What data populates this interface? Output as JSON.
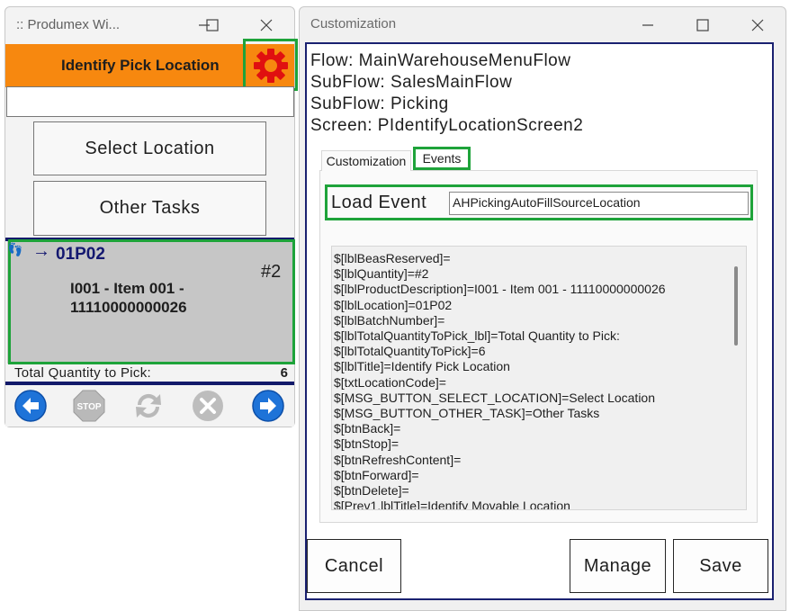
{
  "left_window": {
    "title": ":: Produmex Wi...",
    "header": "Identify Pick Location",
    "input_value": "",
    "buttons": {
      "select_location": "Select Location",
      "other_tasks": "Other Tasks"
    },
    "task": {
      "location": "01P02",
      "count": "#2",
      "item_line1": "I001 - Item 001 -",
      "item_line2": "11110000000026"
    },
    "total": {
      "label": "Total Quantity to Pick:",
      "value": "6"
    },
    "nav_icons": [
      "back-arrow-icon",
      "stop-icon",
      "refresh-icon",
      "delete-icon",
      "forward-arrow-icon"
    ]
  },
  "right_window": {
    "title": "Customization",
    "flow": "Flow: MainWarehouseMenuFlow",
    "subflow1": "SubFlow: SalesMainFlow",
    "subflow2": "SubFlow: Picking",
    "screen": "Screen: PIdentifyLocationScreen2",
    "tabs": [
      "Customization",
      "Events"
    ],
    "active_tab": "Events",
    "load_event_label": "Load Event",
    "load_event_value": "AHPickingAutoFillSourceLocation",
    "script_lines": [
      "$[lblBeasReserved]=",
      "$[lblQuantity]=#2",
      "$[lblProductDescription]=I001 - Item 001 - 11110000000026",
      "$[lblLocation]=01P02",
      "$[lblBatchNumber]=",
      "$[lblTotalQuantityToPick_lbl]=Total Quantity to Pick:",
      "$[lblTotalQuantityToPick]=6",
      "$[lblTitle]=Identify Pick Location",
      "$[txtLocationCode]=",
      "$[MSG_BUTTON_SELECT_LOCATION]=Select Location",
      "$[MSG_BUTTON_OTHER_TASK]=Other Tasks",
      "$[btnBack]=",
      "$[btnStop]=",
      "$[btnRefreshContent]=",
      "$[btnForward]=",
      "$[btnDelete]=",
      "$[Prev1.lblTitle]=Identify Movable Location"
    ],
    "buttons": {
      "cancel": "Cancel",
      "manage": "Manage",
      "save": "Save"
    }
  },
  "colors": {
    "header_orange": "#f7880f",
    "highlight_green": "#1ea33a",
    "navy": "#121a6a",
    "location_blue": "#141870",
    "nav_blue": "#1e73d8"
  }
}
